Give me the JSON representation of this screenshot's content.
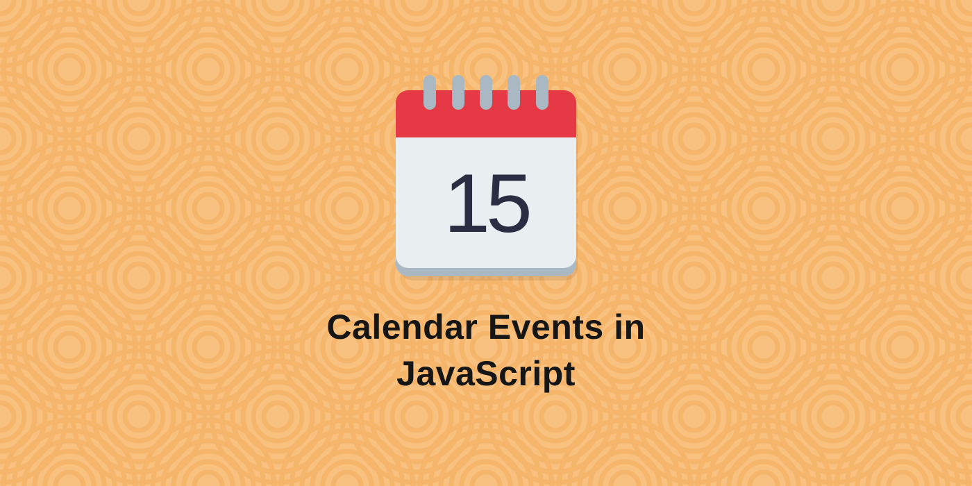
{
  "calendar": {
    "date_number": "15"
  },
  "heading": {
    "line1": "Calendar Events in",
    "line2": "JavaScript"
  },
  "colors": {
    "background": "#f8c180",
    "pattern_stroke": "#f5b56a",
    "calendar_header": "#e63946",
    "calendar_body": "#e9eef0",
    "calendar_ring": "#a9b8c2",
    "calendar_bottom": "#a9b8c2",
    "text": "#161616",
    "date_text": "#2b2d42"
  }
}
